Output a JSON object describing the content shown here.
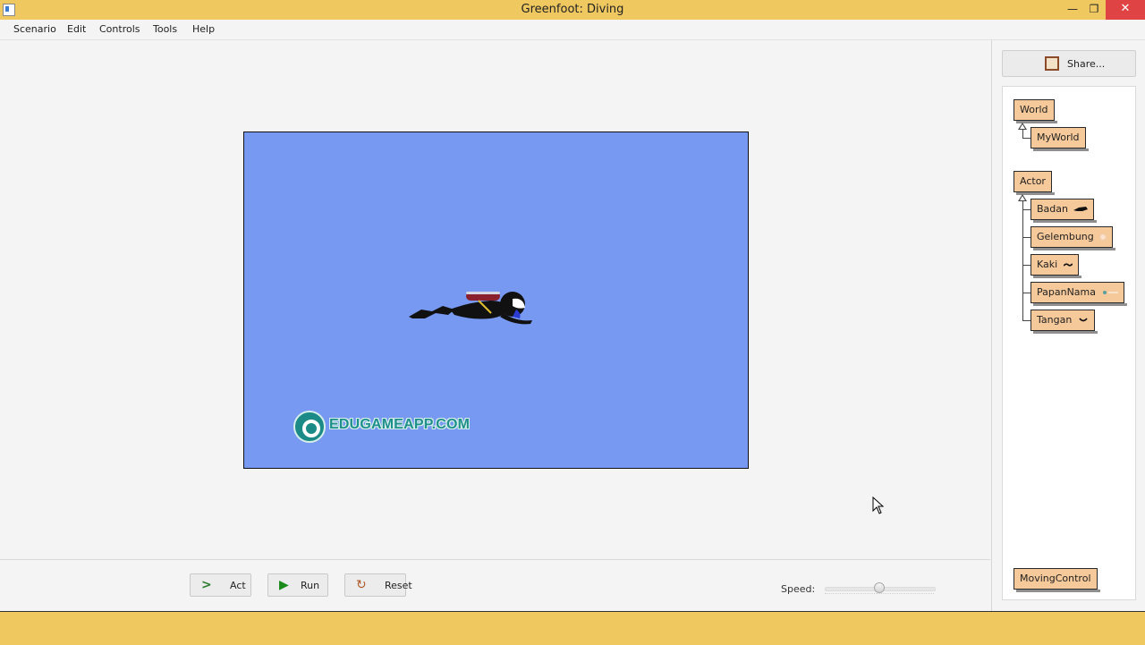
{
  "window": {
    "title": "Greenfoot: Diving"
  },
  "menu": [
    "Scenario",
    "Edit",
    "Controls",
    "Tools",
    "Help"
  ],
  "world": {
    "background": "#7899f2",
    "watermark_text": "EDUGAMEAPP.COM"
  },
  "controls": {
    "act_label": "Act",
    "run_label": "Run",
    "reset_label": "Reset",
    "speed_label": "Speed:",
    "speed_fraction": 0.5
  },
  "share": {
    "label": "Share..."
  },
  "classes": {
    "world": "World",
    "myworld": "MyWorld",
    "actor": "Actor",
    "actor_subclasses": [
      "Badan",
      "Gelembung",
      "Kaki",
      "PapanNama",
      "Tangan"
    ],
    "other": "MovingControl"
  },
  "colors": {
    "titlebar": "#f0c860",
    "class_box": "#f6c99a",
    "world_bg": "#7899f2",
    "close_button": "#e04343"
  }
}
